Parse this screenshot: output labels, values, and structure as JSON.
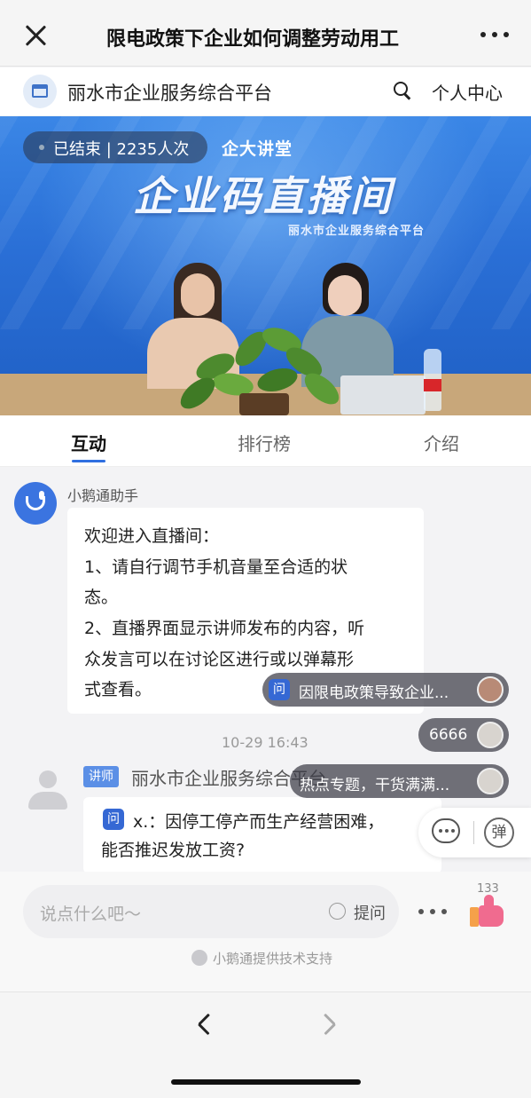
{
  "window": {
    "title": "限电政策下企业如何调整劳动用工",
    "close_icon": "close-icon",
    "more_icon": "more-icon"
  },
  "platform": {
    "name": "丽水市企业服务综合平台",
    "logo_icon": "shop-icon",
    "search_icon": "search-icon",
    "personal_center": "个人中心"
  },
  "video": {
    "status": "已结束",
    "viewers": "2235人次",
    "status_text": "已结束 | 2235人次",
    "subtitle": "企大讲堂",
    "banner_title": "企业码直播间",
    "banner_org": "丽水市企业服务综合平台"
  },
  "tabs": [
    {
      "label": "互动",
      "active": true
    },
    {
      "label": "排行榜",
      "active": false
    },
    {
      "label": "介绍",
      "active": false
    }
  ],
  "assistant": {
    "name": "小鹅通助手",
    "message_lines": [
      "欢迎进入直播间：",
      "1、请自行调节手机音量至合适的状",
      "态。",
      "2、直播界面显示讲师发布的内容，听",
      "众发言可以在讨论区进行或以弹幕形",
      "式查看。"
    ]
  },
  "timestamp": "10-29 16:43",
  "lecturer": {
    "badge": "讲师",
    "name": "丽水市企业服务综合平台",
    "question_badge": "问",
    "question_line1": "x.：因停工停产而生产经营困难，",
    "question_line2": "能否推迟发放工资?"
  },
  "danmaku": [
    {
      "badge": "问",
      "text": "因限电政策导致企业..."
    },
    {
      "text": "6666"
    },
    {
      "text": "热点专题，干货满满..."
    }
  ],
  "float_actions": {
    "comment_icon": "chat-bubble-icon",
    "danmu_label": "弹"
  },
  "input": {
    "placeholder": "说点什么吧～",
    "ask_label": "提问",
    "like_count": "133",
    "support_text": "小鹅通提供技术支持"
  },
  "nav": {
    "back_icon": "chevron-left-icon",
    "forward_icon": "chevron-right-icon"
  }
}
